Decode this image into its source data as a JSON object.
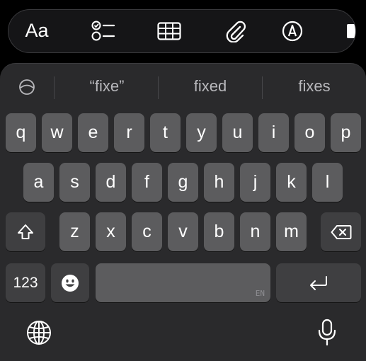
{
  "toolbar": {
    "format_label": "Aa",
    "icons": [
      "checklist-icon",
      "table-icon",
      "paperclip-icon",
      "markup-pen-icon",
      "more-partial-icon"
    ]
  },
  "predictions": {
    "icon": "prediction-toggle-icon",
    "items": [
      "“fixe”",
      "fixed",
      "fixes"
    ]
  },
  "keyboard": {
    "row1": [
      "q",
      "w",
      "e",
      "r",
      "t",
      "y",
      "u",
      "i",
      "o",
      "p"
    ],
    "row2": [
      "a",
      "s",
      "d",
      "f",
      "g",
      "h",
      "j",
      "k",
      "l"
    ],
    "row3": [
      "z",
      "x",
      "c",
      "v",
      "b",
      "n",
      "m"
    ],
    "numbers_label": "123",
    "space_language": "EN",
    "shift_icon": "shift-icon",
    "delete_icon": "backspace-icon",
    "emoji_icon": "emoji-icon",
    "return_icon": "return-icon",
    "globe_icon": "globe-icon",
    "mic_icon": "microphone-icon"
  },
  "colors": {
    "keyboard_bg": "#2a2a2c",
    "key": "#5c5c5e",
    "function_key": "#3f3f41",
    "toolbar_bg": "#151517"
  }
}
